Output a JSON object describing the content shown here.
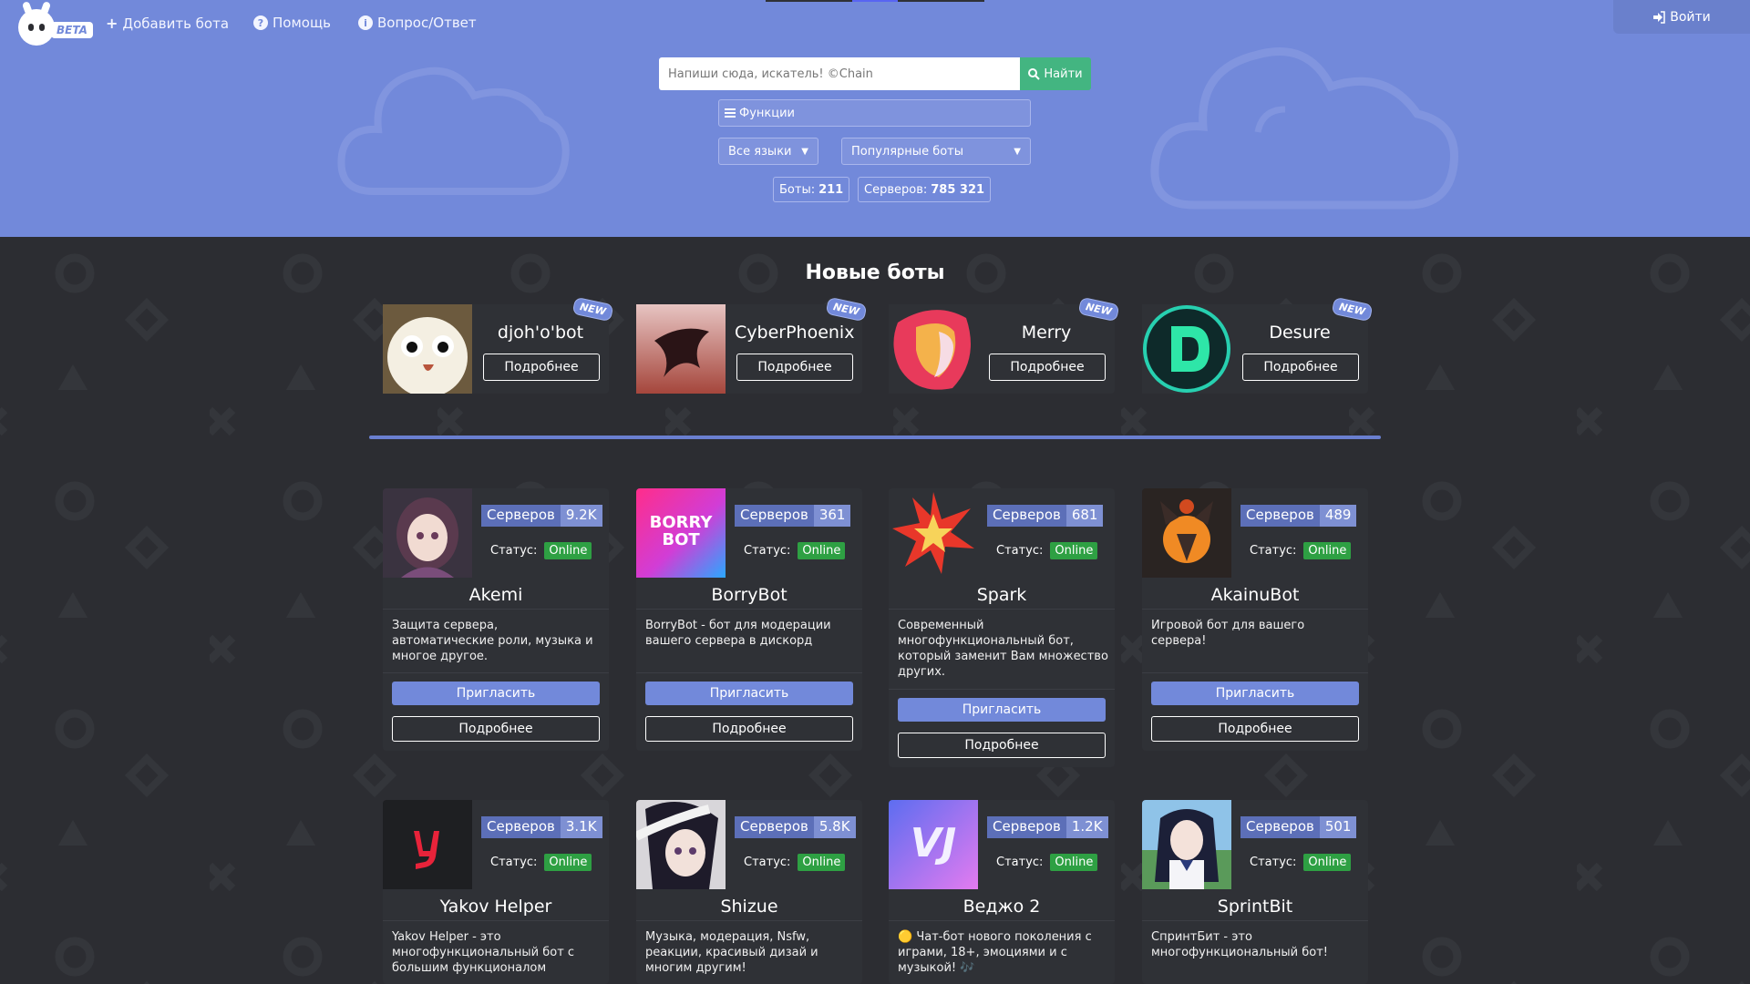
{
  "nav": {
    "logo_badge": "BETA",
    "add_bot": "Добавить бота",
    "help": "Помощь",
    "faq": "Вопрос/Ответ",
    "login": "Войти"
  },
  "search": {
    "placeholder": "Напиши сюда, искатель! ©Chain",
    "button": "Найти"
  },
  "functions_label": "Функции",
  "filters": {
    "language": "Все языки",
    "sort": "Популярные боты"
  },
  "stats": {
    "bots_label": "Боты:",
    "bots_value": "211",
    "servers_label": "Серверов:",
    "servers_value": "785 321"
  },
  "new_bots": {
    "title": "Новые боты",
    "badge": "NEW",
    "button": "Подробнее",
    "items": [
      {
        "name": "djoh'o'bot",
        "avatar": "owl-avatar"
      },
      {
        "name": "CyberPhoenix",
        "avatar": "phoenix-avatar"
      },
      {
        "name": "Merry",
        "avatar": "merry-avatar"
      },
      {
        "name": "Desure",
        "avatar": "desure-avatar"
      }
    ]
  },
  "bot_list": {
    "servers_label": "Серверов",
    "status_label": "Статус:",
    "online_label": "Online",
    "invite_label": "Пригласить",
    "details_label": "Подробнее",
    "items": [
      {
        "name": "Akemi",
        "servers": "9.2K",
        "desc": "Защита сервера, автоматические роли, музыка и многое другое."
      },
      {
        "name": "BorryBot",
        "servers": "361",
        "desc": "BorryBot - бот для модерации вашего сервера в дискорд",
        "avatar_text": "BORRY BOT"
      },
      {
        "name": "Spark",
        "servers": "681",
        "desc": "Современный многофункциональный бот, который заменит Вам множество других."
      },
      {
        "name": "AkainuBot",
        "servers": "489",
        "desc": "Игровой бот для вашего сервера!"
      },
      {
        "name": "Yakov Helper",
        "servers": "3.1K",
        "desc": "Yakov Helper - это многофункциональный бот с большим функционалом"
      },
      {
        "name": "Shizue",
        "servers": "5.8K",
        "desc": "Музыка, модерация, Nsfw, реакции, красивый дизай и многим другим!"
      },
      {
        "name": "Веджо 2",
        "servers": "1.2K",
        "desc": "🟡 Чат-бот нового поколения с играми, 18+, эмоциями и с музыкой! 🎶",
        "avatar_text": "VJ"
      },
      {
        "name": "SprintBit",
        "servers": "501",
        "desc": "СпринтБит - это многофункциональный бот!"
      }
    ]
  },
  "colors": {
    "hero": "#7289da",
    "body": "#2c2d32",
    "card": "#2f3136",
    "search_button": "#43b581",
    "online": "#2ea043"
  }
}
